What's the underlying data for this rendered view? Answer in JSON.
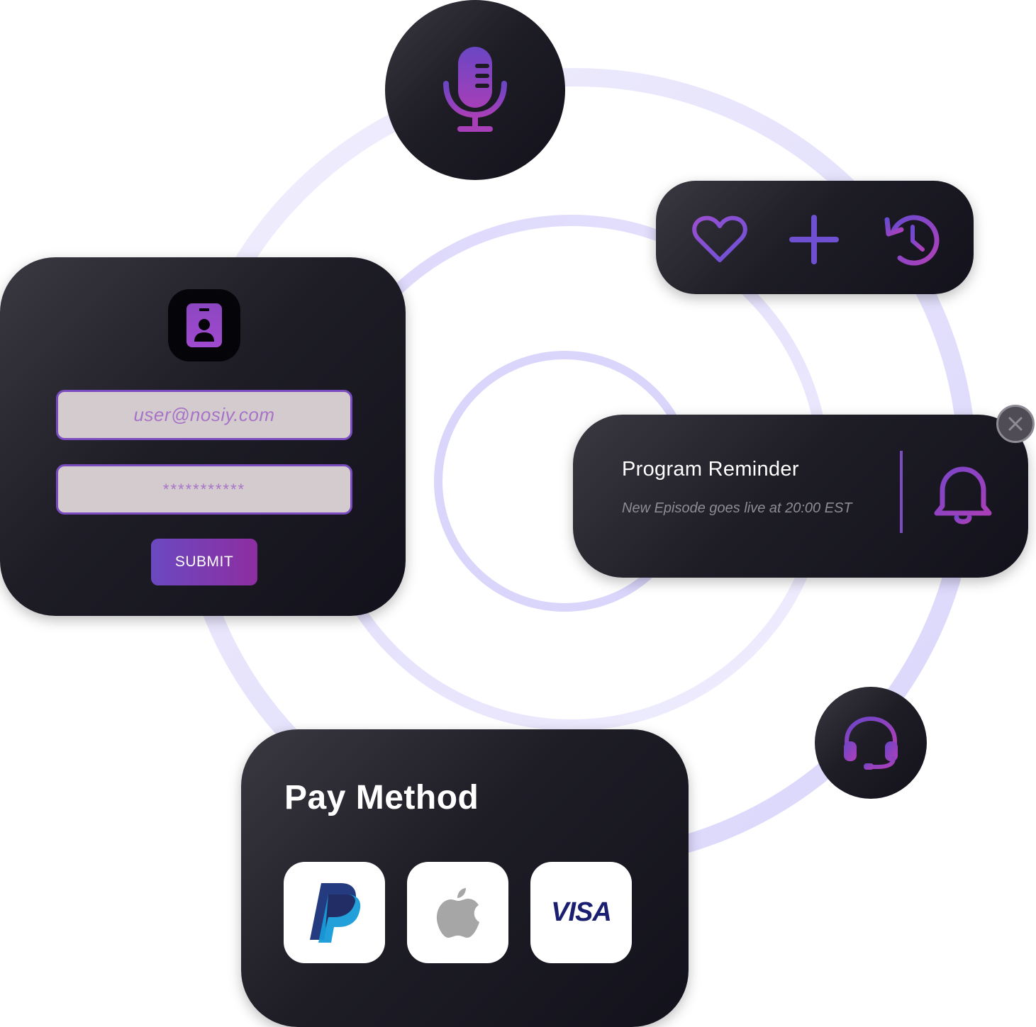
{
  "login": {
    "email_value": "user@nosiy.com",
    "password_value": "***********",
    "submit_label": "SUBMIT"
  },
  "reminder": {
    "title": "Program Reminder",
    "subtitle": "New Episode goes live at 20:00 EST"
  },
  "actions": {
    "icons": [
      "heart-icon",
      "plus-icon",
      "history-icon"
    ]
  },
  "payment": {
    "title": "Pay Method",
    "methods": [
      "paypal",
      "apple",
      "visa"
    ],
    "visa_label": "VISA"
  },
  "colors": {
    "accent_purple": "#7a4cc0",
    "accent_magenta": "#8d2ea0",
    "card_dark": "#13121c",
    "ring_light": "#e5e1fb"
  }
}
